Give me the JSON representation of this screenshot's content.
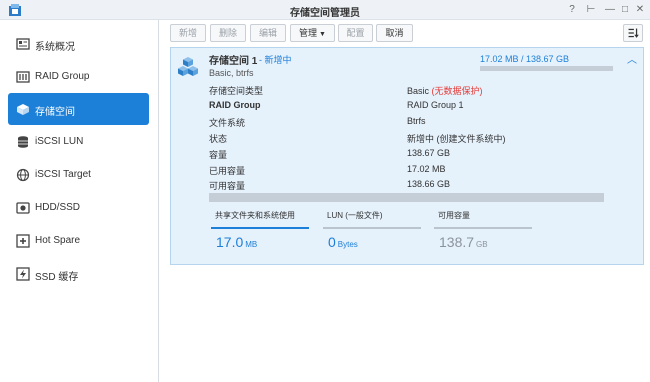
{
  "window": {
    "title": "存储空间管理员",
    "help": "?",
    "pin": "⊢",
    "minimize": "—",
    "maximize": "□",
    "close": "✕"
  },
  "sidebar": {
    "items": [
      {
        "label": "系统概况",
        "icon": "overview-icon"
      },
      {
        "label": "RAID Group",
        "icon": "raid-icon"
      },
      {
        "label": "存储空间",
        "icon": "volume-icon"
      },
      {
        "label": "iSCSI LUN",
        "icon": "database-icon"
      },
      {
        "label": "iSCSI Target",
        "icon": "globe-icon"
      },
      {
        "label": "HDD/SSD",
        "icon": "hdd-icon"
      },
      {
        "label": "Hot Spare",
        "icon": "plus-box-icon"
      },
      {
        "label": "SSD 缓存",
        "icon": "lightning-icon"
      }
    ],
    "active_index": 2
  },
  "toolbar": {
    "new": "新增",
    "delete": "删除",
    "edit": "编辑",
    "manage": "管理",
    "config": "配置",
    "cancel": "取消"
  },
  "volume": {
    "name": "存储空间 1",
    "status": "- 新增中",
    "subtitle": "Basic, btrfs",
    "usage_text": "17.02 MB / 138.67 GB",
    "usage_fraction": 0.0001,
    "details": [
      {
        "key": "存储空间类型",
        "value": "Basic",
        "extra": "(无数据保护)"
      },
      {
        "key": "RAID Group",
        "value": "RAID Group 1"
      },
      {
        "key": "文件系统",
        "value": "Btrfs"
      },
      {
        "key": "状态",
        "value": "新增中 (创建文件系统中)"
      },
      {
        "key": "容量",
        "value": "138.67 GB"
      },
      {
        "key": "已用容量",
        "value": "17.02 MB"
      },
      {
        "key": "可用容量",
        "value": "138.66 GB"
      }
    ],
    "stats": [
      {
        "label": "共享文件夹和系统使用",
        "value": "17.0",
        "unit": "MB"
      },
      {
        "label": "LUN (一般文件)",
        "value": "0",
        "unit": "Bytes"
      },
      {
        "label": "可用容量",
        "value": "138.7",
        "unit": "GB"
      }
    ]
  },
  "colors": {
    "accent": "#1d80d8",
    "card_bg": "#e5f1fb",
    "warning": "#e53935"
  }
}
